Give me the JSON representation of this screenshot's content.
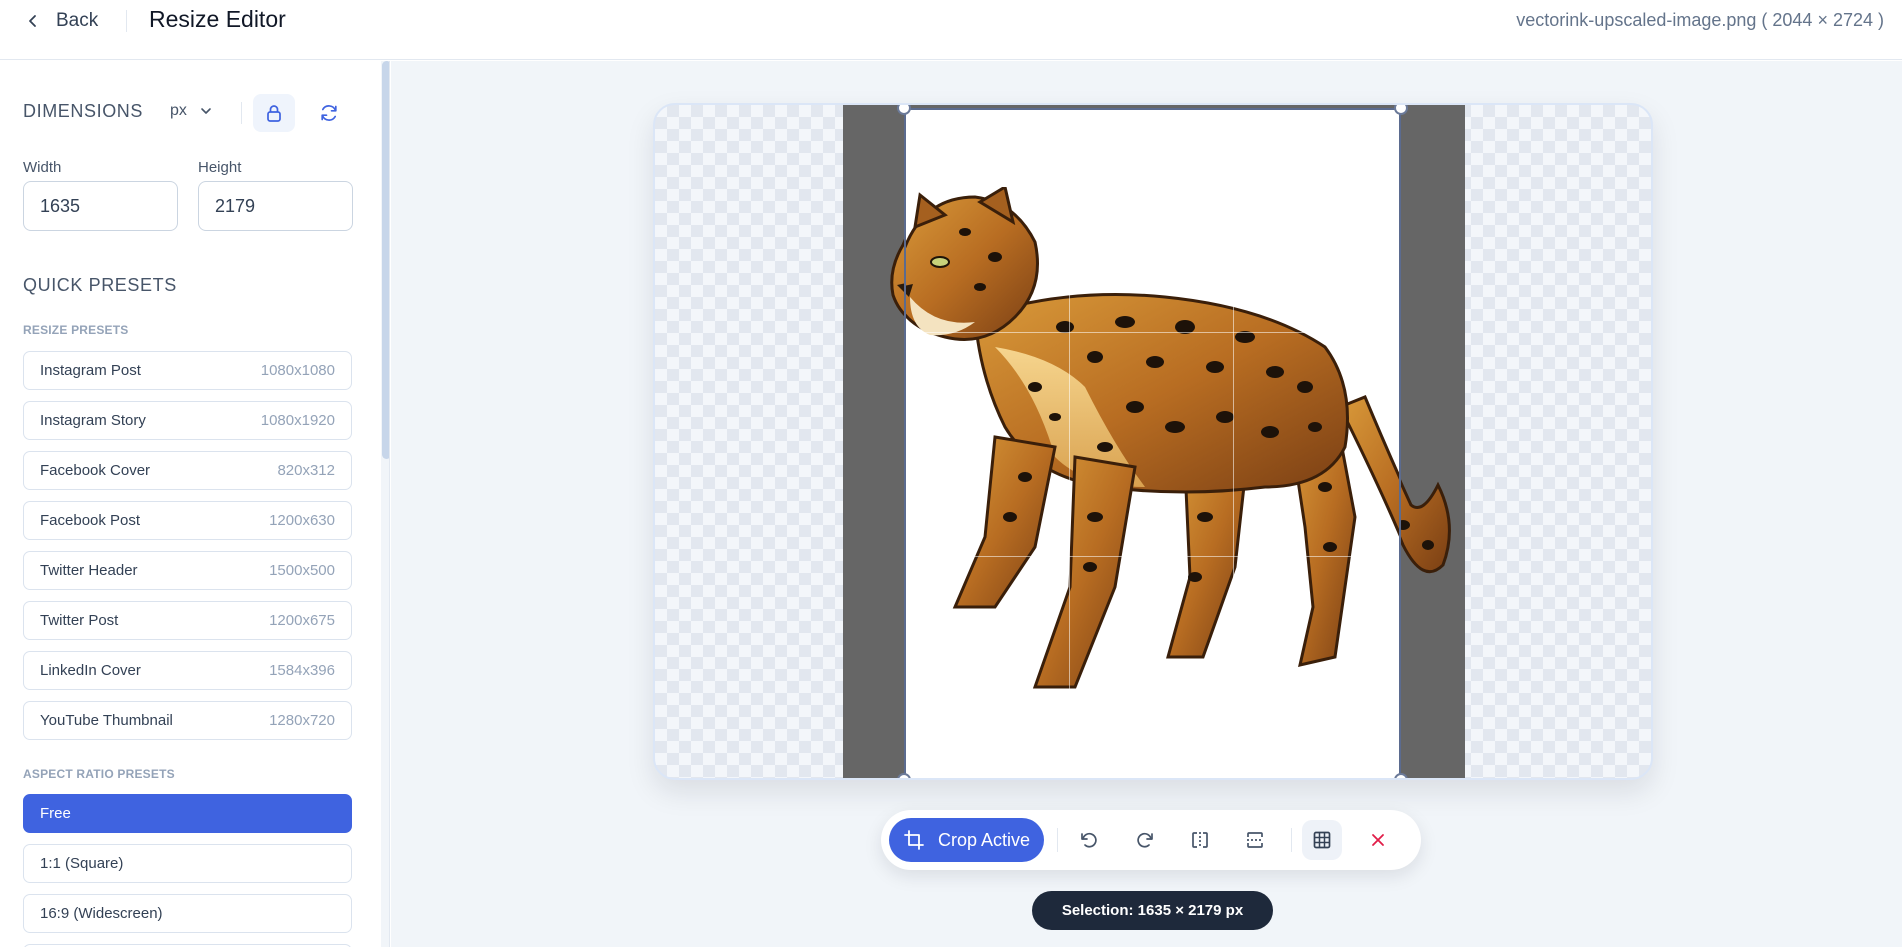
{
  "header": {
    "back_label": "Back",
    "title": "Resize Editor",
    "file_info": "vectorink-upscaled-image.png ( 2044 × 2724 )"
  },
  "sidebar": {
    "dimensions_title": "DIMENSIONS",
    "unit": "px",
    "width_label": "Width",
    "width_value": "1635",
    "height_label": "Height",
    "height_value": "2179",
    "quick_presets_title": "QUICK PRESETS",
    "resize_presets_title": "RESIZE PRESETS",
    "resize_presets": [
      {
        "name": "Instagram Post",
        "size": "1080x1080"
      },
      {
        "name": "Instagram Story",
        "size": "1080x1920"
      },
      {
        "name": "Facebook Cover",
        "size": "820x312"
      },
      {
        "name": "Facebook Post",
        "size": "1200x630"
      },
      {
        "name": "Twitter Header",
        "size": "1500x500"
      },
      {
        "name": "Twitter Post",
        "size": "1200x675"
      },
      {
        "name": "LinkedIn Cover",
        "size": "1584x396"
      },
      {
        "name": "YouTube Thumbnail",
        "size": "1280x720"
      }
    ],
    "aspect_ratio_title": "ASPECT RATIO PRESETS",
    "aspect_ratios": [
      {
        "label": "Free",
        "active": true
      },
      {
        "label": "1:1 (Square)",
        "active": false
      },
      {
        "label": "16:9 (Widescreen)",
        "active": false
      }
    ]
  },
  "toolbar": {
    "crop_label": "Crop Active",
    "tools": [
      "rotate-left-icon",
      "rotate-right-icon",
      "flip-horizontal-icon",
      "flip-vertical-icon",
      "grid-icon",
      "close-icon"
    ]
  },
  "selection_text": "Selection: 1635 × 2179 px",
  "colors": {
    "accent": "#3f63e0",
    "danger": "#e11d48",
    "pill_bg": "#1e293b"
  }
}
